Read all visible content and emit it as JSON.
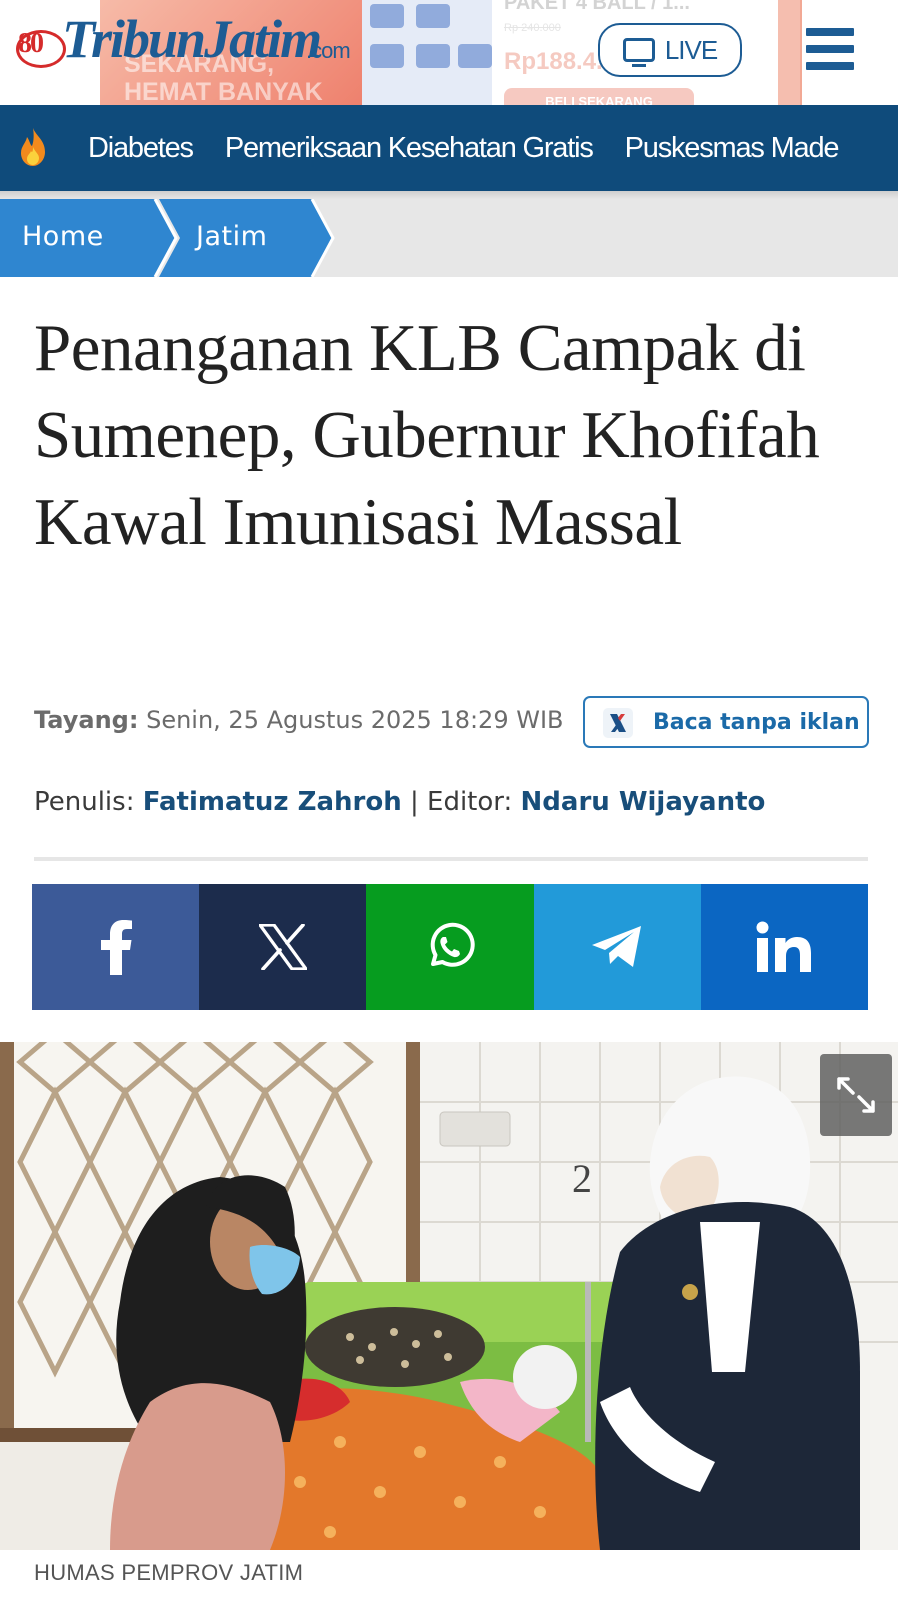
{
  "header": {
    "logo_text": "TribunJatim",
    "logo_badge": "80",
    "logo_domain": ".com",
    "live_label": "LIVE",
    "ad": {
      "promo_text": "SEKARANG, HEMAT BANYAK",
      "product_title": "PAKET 4 BALL / 1...",
      "old_price": "Rp 240.000",
      "price": "Rp188.4..",
      "buy_label": "BELI SEKARANG"
    }
  },
  "trending": {
    "items": [
      {
        "label": "Diabetes"
      },
      {
        "label": "Pemeriksaan Kesehatan Gratis"
      },
      {
        "label": "Puskesmas Made"
      }
    ]
  },
  "breadcrumb": [
    {
      "label": "Home"
    },
    {
      "label": "Jatim"
    }
  ],
  "article": {
    "title": "Penanganan KLB Campak di Sumenep, Gubernur Khofifah Kawal Imunisasi Massal",
    "published_label": "Tayang:",
    "published_value": "Senin, 25 Agustus 2025 18:29 WIB",
    "ad_free_label": "Baca tanpa iklan",
    "writer_label": "Penulis:",
    "writer": "Fatimatuz Zahroh",
    "separator": "|",
    "editor_label": "Editor:",
    "editor": "Ndaru Wijayanto",
    "photo_caption": "HUMAS PEMPROV JATIM",
    "photo_bed_number": "2"
  },
  "share": [
    {
      "icon": "facebook-icon",
      "color": "#3c5a98"
    },
    {
      "icon": "x-icon",
      "color": "#1c2c4c"
    },
    {
      "icon": "whatsapp-icon",
      "color": "#069c1f"
    },
    {
      "icon": "telegram-icon",
      "color": "#229ad9"
    },
    {
      "icon": "linkedin-icon",
      "color": "#0b66c2"
    }
  ],
  "colors": {
    "brand": "#1d5c94",
    "nav_bg": "#0f4b7b",
    "breadcrumb": "#2f86d0",
    "link": "#184e7a"
  }
}
